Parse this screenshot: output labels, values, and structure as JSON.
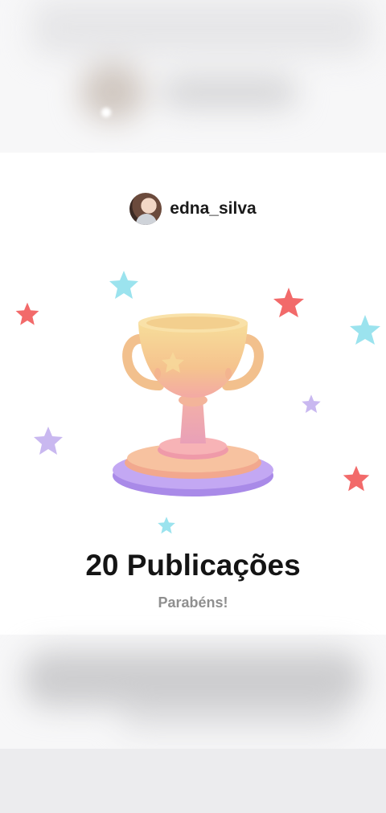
{
  "profile": {
    "username": "edna_silva"
  },
  "achievement": {
    "title": "20 Publicações",
    "subtitle": "Parabéns!"
  },
  "colors": {
    "star_red": "#f26a6a",
    "star_cyan": "#9be3ee",
    "star_lilac": "#c9b8f0",
    "trophy_gold": "#f6c98e",
    "trophy_pink": "#f4a7a5",
    "base_purple": "#b89af0"
  }
}
